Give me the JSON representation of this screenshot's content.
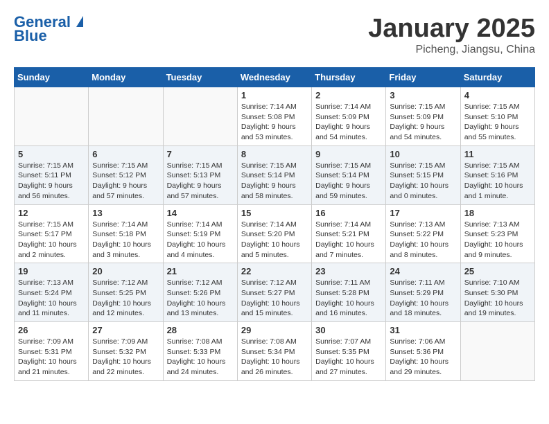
{
  "header": {
    "logo_line1": "General",
    "logo_line2": "Blue",
    "month": "January 2025",
    "location": "Picheng, Jiangsu, China"
  },
  "days_of_week": [
    "Sunday",
    "Monday",
    "Tuesday",
    "Wednesday",
    "Thursday",
    "Friday",
    "Saturday"
  ],
  "weeks": [
    [
      {
        "day": "",
        "sunrise": "",
        "sunset": "",
        "daylight": ""
      },
      {
        "day": "",
        "sunrise": "",
        "sunset": "",
        "daylight": ""
      },
      {
        "day": "",
        "sunrise": "",
        "sunset": "",
        "daylight": ""
      },
      {
        "day": "1",
        "sunrise": "Sunrise: 7:14 AM",
        "sunset": "Sunset: 5:08 PM",
        "daylight": "Daylight: 9 hours and 53 minutes."
      },
      {
        "day": "2",
        "sunrise": "Sunrise: 7:14 AM",
        "sunset": "Sunset: 5:09 PM",
        "daylight": "Daylight: 9 hours and 54 minutes."
      },
      {
        "day": "3",
        "sunrise": "Sunrise: 7:15 AM",
        "sunset": "Sunset: 5:09 PM",
        "daylight": "Daylight: 9 hours and 54 minutes."
      },
      {
        "day": "4",
        "sunrise": "Sunrise: 7:15 AM",
        "sunset": "Sunset: 5:10 PM",
        "daylight": "Daylight: 9 hours and 55 minutes."
      }
    ],
    [
      {
        "day": "5",
        "sunrise": "Sunrise: 7:15 AM",
        "sunset": "Sunset: 5:11 PM",
        "daylight": "Daylight: 9 hours and 56 minutes."
      },
      {
        "day": "6",
        "sunrise": "Sunrise: 7:15 AM",
        "sunset": "Sunset: 5:12 PM",
        "daylight": "Daylight: 9 hours and 57 minutes."
      },
      {
        "day": "7",
        "sunrise": "Sunrise: 7:15 AM",
        "sunset": "Sunset: 5:13 PM",
        "daylight": "Daylight: 9 hours and 57 minutes."
      },
      {
        "day": "8",
        "sunrise": "Sunrise: 7:15 AM",
        "sunset": "Sunset: 5:14 PM",
        "daylight": "Daylight: 9 hours and 58 minutes."
      },
      {
        "day": "9",
        "sunrise": "Sunrise: 7:15 AM",
        "sunset": "Sunset: 5:14 PM",
        "daylight": "Daylight: 9 hours and 59 minutes."
      },
      {
        "day": "10",
        "sunrise": "Sunrise: 7:15 AM",
        "sunset": "Sunset: 5:15 PM",
        "daylight": "Daylight: 10 hours and 0 minutes."
      },
      {
        "day": "11",
        "sunrise": "Sunrise: 7:15 AM",
        "sunset": "Sunset: 5:16 PM",
        "daylight": "Daylight: 10 hours and 1 minute."
      }
    ],
    [
      {
        "day": "12",
        "sunrise": "Sunrise: 7:15 AM",
        "sunset": "Sunset: 5:17 PM",
        "daylight": "Daylight: 10 hours and 2 minutes."
      },
      {
        "day": "13",
        "sunrise": "Sunrise: 7:14 AM",
        "sunset": "Sunset: 5:18 PM",
        "daylight": "Daylight: 10 hours and 3 minutes."
      },
      {
        "day": "14",
        "sunrise": "Sunrise: 7:14 AM",
        "sunset": "Sunset: 5:19 PM",
        "daylight": "Daylight: 10 hours and 4 minutes."
      },
      {
        "day": "15",
        "sunrise": "Sunrise: 7:14 AM",
        "sunset": "Sunset: 5:20 PM",
        "daylight": "Daylight: 10 hours and 5 minutes."
      },
      {
        "day": "16",
        "sunrise": "Sunrise: 7:14 AM",
        "sunset": "Sunset: 5:21 PM",
        "daylight": "Daylight: 10 hours and 7 minutes."
      },
      {
        "day": "17",
        "sunrise": "Sunrise: 7:13 AM",
        "sunset": "Sunset: 5:22 PM",
        "daylight": "Daylight: 10 hours and 8 minutes."
      },
      {
        "day": "18",
        "sunrise": "Sunrise: 7:13 AM",
        "sunset": "Sunset: 5:23 PM",
        "daylight": "Daylight: 10 hours and 9 minutes."
      }
    ],
    [
      {
        "day": "19",
        "sunrise": "Sunrise: 7:13 AM",
        "sunset": "Sunset: 5:24 PM",
        "daylight": "Daylight: 10 hours and 11 minutes."
      },
      {
        "day": "20",
        "sunrise": "Sunrise: 7:12 AM",
        "sunset": "Sunset: 5:25 PM",
        "daylight": "Daylight: 10 hours and 12 minutes."
      },
      {
        "day": "21",
        "sunrise": "Sunrise: 7:12 AM",
        "sunset": "Sunset: 5:26 PM",
        "daylight": "Daylight: 10 hours and 13 minutes."
      },
      {
        "day": "22",
        "sunrise": "Sunrise: 7:12 AM",
        "sunset": "Sunset: 5:27 PM",
        "daylight": "Daylight: 10 hours and 15 minutes."
      },
      {
        "day": "23",
        "sunrise": "Sunrise: 7:11 AM",
        "sunset": "Sunset: 5:28 PM",
        "daylight": "Daylight: 10 hours and 16 minutes."
      },
      {
        "day": "24",
        "sunrise": "Sunrise: 7:11 AM",
        "sunset": "Sunset: 5:29 PM",
        "daylight": "Daylight: 10 hours and 18 minutes."
      },
      {
        "day": "25",
        "sunrise": "Sunrise: 7:10 AM",
        "sunset": "Sunset: 5:30 PM",
        "daylight": "Daylight: 10 hours and 19 minutes."
      }
    ],
    [
      {
        "day": "26",
        "sunrise": "Sunrise: 7:09 AM",
        "sunset": "Sunset: 5:31 PM",
        "daylight": "Daylight: 10 hours and 21 minutes."
      },
      {
        "day": "27",
        "sunrise": "Sunrise: 7:09 AM",
        "sunset": "Sunset: 5:32 PM",
        "daylight": "Daylight: 10 hours and 22 minutes."
      },
      {
        "day": "28",
        "sunrise": "Sunrise: 7:08 AM",
        "sunset": "Sunset: 5:33 PM",
        "daylight": "Daylight: 10 hours and 24 minutes."
      },
      {
        "day": "29",
        "sunrise": "Sunrise: 7:08 AM",
        "sunset": "Sunset: 5:34 PM",
        "daylight": "Daylight: 10 hours and 26 minutes."
      },
      {
        "day": "30",
        "sunrise": "Sunrise: 7:07 AM",
        "sunset": "Sunset: 5:35 PM",
        "daylight": "Daylight: 10 hours and 27 minutes."
      },
      {
        "day": "31",
        "sunrise": "Sunrise: 7:06 AM",
        "sunset": "Sunset: 5:36 PM",
        "daylight": "Daylight: 10 hours and 29 minutes."
      },
      {
        "day": "",
        "sunrise": "",
        "sunset": "",
        "daylight": ""
      }
    ]
  ]
}
